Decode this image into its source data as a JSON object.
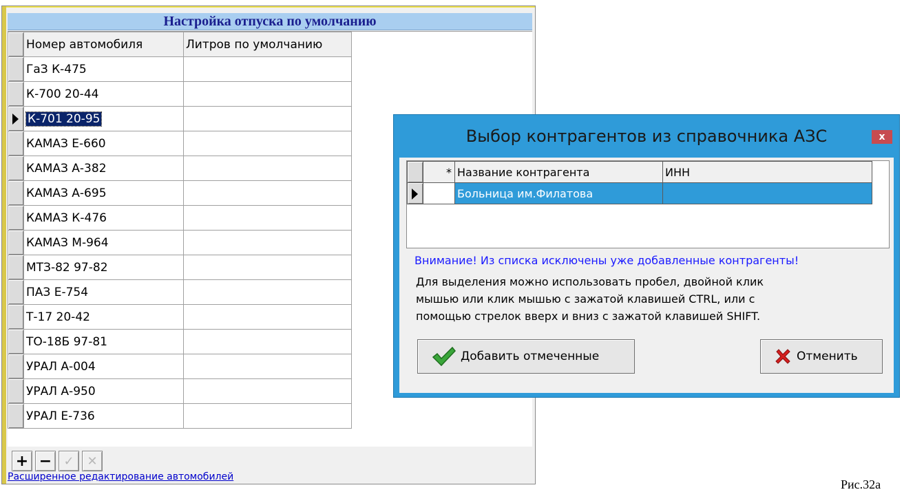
{
  "left_window": {
    "title": "Настройка отпуска по умолчанию",
    "columns": [
      "Номер автомобиля",
      "Литров по умолчанию"
    ],
    "rows": [
      {
        "number": "ГаЗ К-475",
        "liters": ""
      },
      {
        "number": "К-700 20-44",
        "liters": ""
      },
      {
        "number": "К-701 20-95",
        "liters": ""
      },
      {
        "number": "КАМАЗ  Е-660",
        "liters": ""
      },
      {
        "number": "КАМАЗ А-382",
        "liters": ""
      },
      {
        "number": "КАМАЗ А-695",
        "liters": ""
      },
      {
        "number": "КАМАЗ К-476",
        "liters": ""
      },
      {
        "number": "КАМАЗ М-964",
        "liters": ""
      },
      {
        "number": "МТЗ-82 97-82",
        "liters": ""
      },
      {
        "number": "ПАЗ  Е-754",
        "liters": ""
      },
      {
        "number": "Т-17 20-42",
        "liters": ""
      },
      {
        "number": "ТО-18Б 97-81",
        "liters": ""
      },
      {
        "number": "УРАЛ А-004",
        "liters": ""
      },
      {
        "number": "УРАЛ А-950",
        "liters": ""
      },
      {
        "number": "УРАЛ Е-736",
        "liters": ""
      }
    ],
    "current_row_index": 2,
    "toolbar": {
      "add_icon": "plus-icon",
      "remove_icon": "minus-icon",
      "confirm_icon": "check-icon",
      "cancel_icon": "cross-icon"
    },
    "link_label": "Расширенное редактирование автомобилей"
  },
  "dialog": {
    "title": "Выбор контрагентов из справочника АЗС",
    "close_label": "x",
    "columns": {
      "star": "*",
      "name": "Название контрагента",
      "inn": "ИНН"
    },
    "rows": [
      {
        "name": "Больница им.Филатова",
        "inn": ""
      }
    ],
    "warning": "Внимание! Из списка исключены уже добавленные контрагенты!",
    "hint_lines": [
      "Для выделения можно использовать пробел, двойной клик",
      "мышью или клик мышью с зажатой клавишей CTRL, или с",
      "помощью стрелок вверх и вниз с зажатой клавишей SHIFT."
    ],
    "add_button_label": "Добавить отмеченные",
    "cancel_button_label": "Отменить",
    "colors": {
      "title_bar": "#2f9bd9",
      "close": "#c74b50",
      "selection": "#2f9bd9",
      "warning_text": "#1a1aff"
    }
  },
  "caption": "Рис.32а"
}
